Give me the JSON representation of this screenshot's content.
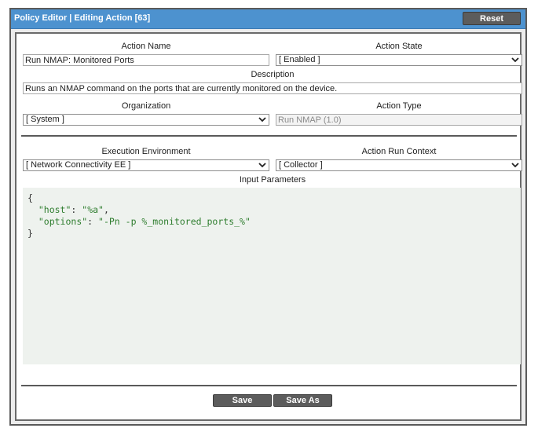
{
  "window": {
    "title": "Policy Editor | Editing Action [63]",
    "reset_label": "Reset"
  },
  "form": {
    "action_name": {
      "label": "Action Name",
      "value": "Run NMAP: Monitored Ports"
    },
    "action_state": {
      "label": "Action State",
      "value": "[ Enabled ]"
    },
    "description": {
      "label": "Description",
      "value": "Runs an NMAP command on the ports that are currently monitored on the device."
    },
    "organization": {
      "label": "Organization",
      "value": "[ System ]"
    },
    "action_type": {
      "label": "Action Type",
      "value": "Run NMAP (1.0)"
    },
    "execution_environment": {
      "label": "Execution Environment",
      "value": "[ Network Connectivity EE ]"
    },
    "action_run_context": {
      "label": "Action Run Context",
      "value": "[ Collector ]"
    },
    "input_parameters": {
      "label": "Input Parameters",
      "lines": [
        {
          "open": "{"
        },
        {
          "key": "\"host\"",
          "sep": ": ",
          "val": "\"%a\"",
          "end": ","
        },
        {
          "key": "\"options\"",
          "sep": ": ",
          "val": "\"-Pn -p %_monitored_ports_%\"",
          "end": ""
        },
        {
          "close": "}"
        }
      ]
    }
  },
  "footer": {
    "save_label": "Save",
    "save_as_label": "Save As"
  },
  "icons": {
    "dropdown": "chevron-down-icon"
  }
}
